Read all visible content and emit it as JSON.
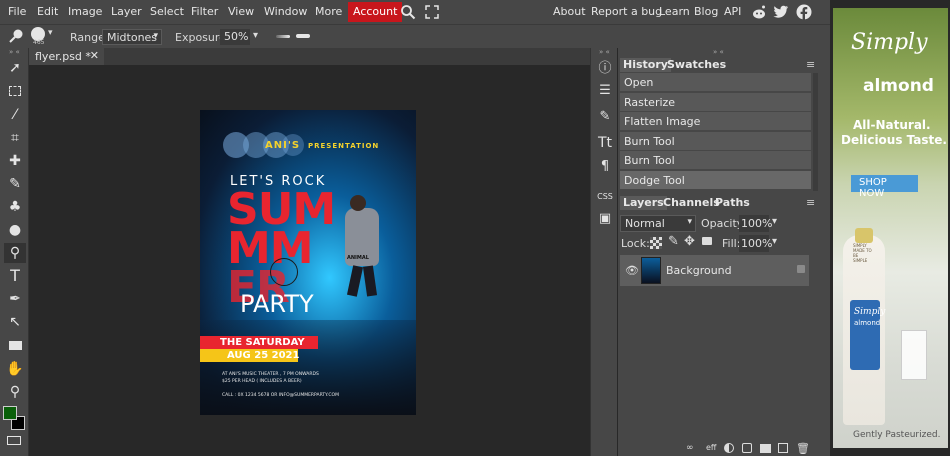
{
  "menu": {
    "items": [
      "File",
      "Edit",
      "Image",
      "Layer",
      "Select",
      "Filter",
      "View",
      "Window",
      "More"
    ],
    "account": "Account",
    "right_links": [
      "About",
      "Report a bug",
      "Learn",
      "Blog",
      "API"
    ]
  },
  "options": {
    "brush_size": "465",
    "range_label": "Range:",
    "range_value": "Midtones",
    "exposure_label": "Exposure:",
    "exposure_value": "50%"
  },
  "document": {
    "tab_title": "flyer.psd *"
  },
  "poster": {
    "brand": "ANI'S",
    "presentation": "PRESENTATION",
    "lets_rock": "LET'S ROCK",
    "summer_1": "SUM",
    "summer_2": "MM",
    "summer_3": "ER",
    "party": "PARTY",
    "the_saturday": "THE SATURDAY",
    "date": "AUG 25 2021",
    "venue": "AT ANI'S MUSIC THEATER , 7 PM ONWARDS",
    "price": "$25 PER HEAD ( INCLUDES A BEER)",
    "contact": "CALL : 0X 1234 5678 OR INFO@SUMMERPARTY.COM",
    "jacket": "ANIMAL"
  },
  "history": {
    "tabs": [
      "History",
      "Swatches"
    ],
    "items": [
      "Open",
      "Rasterize",
      "Flatten Image",
      "Burn Tool",
      "Burn Tool",
      "Dodge Tool"
    ]
  },
  "layers": {
    "tabs": [
      "Layers",
      "Channels",
      "Paths"
    ],
    "blend_mode": "Normal",
    "opacity_label": "Opacity:",
    "opacity_value": "100%",
    "lock_label": "Lock:",
    "fill_label": "Fill:",
    "fill_value": "100%",
    "layer_name": "Background",
    "footer_eff": "eff"
  },
  "ad": {
    "brand_line1": "Simply",
    "brand_line2": "almond",
    "tagline1": "All-Natural.",
    "tagline2": "Delicious Taste.",
    "cta": "SHOP NOW",
    "footer": "Gently Pasteurized.",
    "bottle_side_text": "SIMPLY MADE TO BE SIMPLE"
  },
  "colors": {
    "account_red": "#c8161c",
    "panel_gray": "#474747",
    "foreground_swatch": "#0a5f0a",
    "poster_red": "#e8252f",
    "poster_yellow": "#f5c518",
    "ad_cta": "#4a9ad6"
  }
}
